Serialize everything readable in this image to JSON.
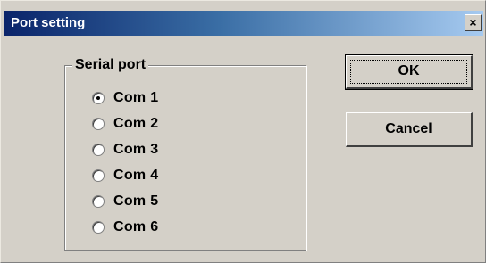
{
  "window": {
    "title": "Port setting",
    "close_glyph": "×",
    "close_icon": "close-icon"
  },
  "group": {
    "label": "Serial port",
    "options": [
      {
        "label": "Com 1",
        "selected": true
      },
      {
        "label": "Com 2",
        "selected": false
      },
      {
        "label": "Com 3",
        "selected": false
      },
      {
        "label": "Com 4",
        "selected": false
      },
      {
        "label": "Com 5",
        "selected": false
      },
      {
        "label": "Com 6",
        "selected": false
      }
    ]
  },
  "buttons": {
    "ok_label": "OK",
    "cancel_label": "Cancel"
  },
  "colors": {
    "face": "#d4d0c8",
    "title_gradient_start": "#0a246a",
    "title_gradient_end": "#a6caf0"
  }
}
